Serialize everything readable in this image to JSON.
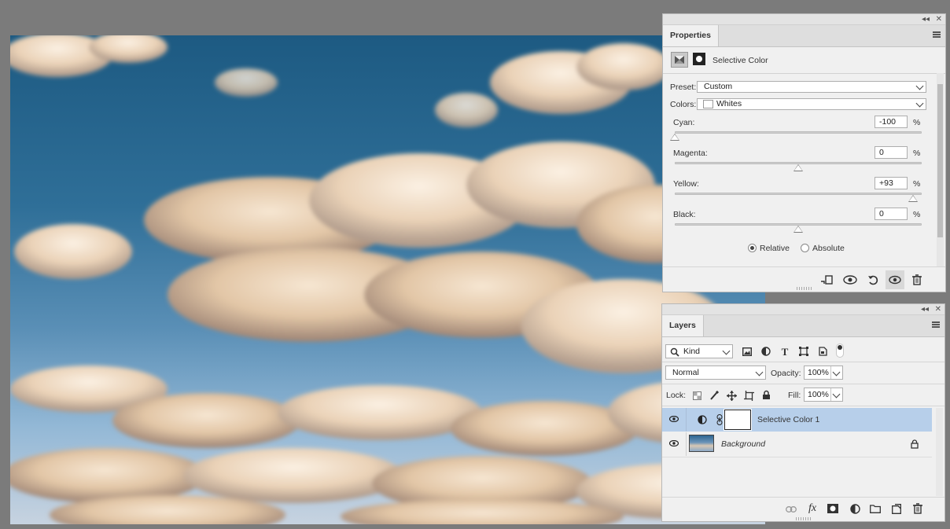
{
  "properties": {
    "tab_label": "Properties",
    "adjustment_name": "Selective Color",
    "preset": {
      "label": "Preset:",
      "value": "Custom"
    },
    "colors": {
      "label": "Colors:",
      "value": "Whites"
    },
    "sliders": [
      {
        "label": "Cyan:",
        "value": "-100",
        "unit": "%",
        "fraction": 0.0
      },
      {
        "label": "Magenta:",
        "value": "0",
        "unit": "%",
        "fraction": 0.5
      },
      {
        "label": "Yellow:",
        "value": "+93",
        "unit": "%",
        "fraction": 0.965
      },
      {
        "label": "Black:",
        "value": "0",
        "unit": "%",
        "fraction": 0.5
      }
    ],
    "method": {
      "relative": "Relative",
      "absolute": "Absolute",
      "selected": "relative"
    },
    "footer_icons": [
      "clip-to-layer-icon",
      "view-previous-icon",
      "reset-icon",
      "visibility-icon",
      "delete-icon"
    ]
  },
  "layers": {
    "tab_label": "Layers",
    "filter": {
      "value": "Kind"
    },
    "filter_icons": [
      "image-filter-icon",
      "adjustment-filter-icon",
      "type-filter-icon",
      "shape-filter-icon",
      "smart-object-filter-icon"
    ],
    "blend_mode": "Normal",
    "opacity": {
      "label": "Opacity:",
      "value": "100%"
    },
    "lock": {
      "label": "Lock:"
    },
    "fill": {
      "label": "Fill:",
      "value": "100%"
    },
    "items": [
      {
        "name": "Selective Color 1",
        "selected": true,
        "italic": false
      },
      {
        "name": "Background",
        "selected": false,
        "italic": true,
        "locked": true
      }
    ],
    "footer_icons": [
      "link-layers-icon",
      "fx-icon",
      "add-mask-icon",
      "new-adjustment-icon",
      "new-group-icon",
      "new-layer-icon",
      "delete-layer-icon"
    ],
    "fx_text": "fx"
  },
  "colors_theme": {
    "selected_row": "#b7cfea",
    "panel_bg": "#f0f0f0",
    "app_bg": "#7b7b7b"
  },
  "topbar": {
    "collapse": "◂◂",
    "close": "✕"
  }
}
